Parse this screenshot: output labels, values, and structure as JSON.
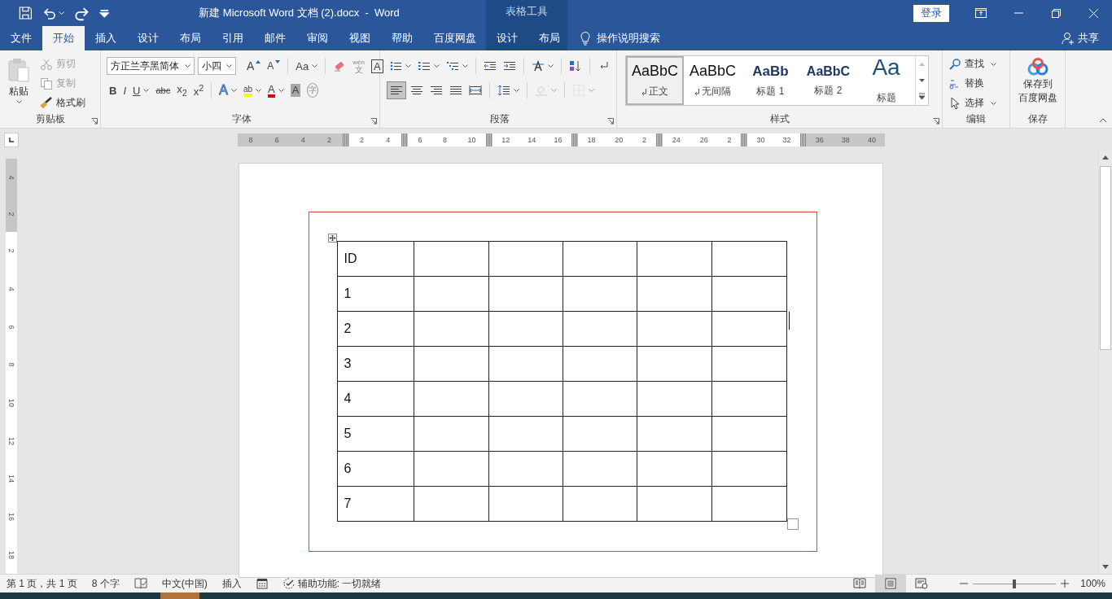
{
  "title_bar": {
    "title": "新建 Microsoft Word 文档 (2).docx  -  Word",
    "context_label": "表格工具",
    "sign_in": "登录"
  },
  "tabs": [
    {
      "label": "文件",
      "selected": false
    },
    {
      "label": "开始",
      "selected": true
    },
    {
      "label": "插入",
      "selected": false
    },
    {
      "label": "设计",
      "selected": false
    },
    {
      "label": "布局",
      "selected": false
    },
    {
      "label": "引用",
      "selected": false
    },
    {
      "label": "邮件",
      "selected": false
    },
    {
      "label": "审阅",
      "selected": false
    },
    {
      "label": "视图",
      "selected": false
    },
    {
      "label": "帮助",
      "selected": false
    },
    {
      "label": "百度网盘",
      "selected": false
    }
  ],
  "context_tabs": [
    {
      "label": "设计",
      "selected": false
    },
    {
      "label": "布局",
      "selected": false
    }
  ],
  "tell_me": "操作说明搜索",
  "share": "共享",
  "clipboard": {
    "label": "剪贴板",
    "paste": "粘贴",
    "items": [
      {
        "kind": "cut",
        "label": "剪切",
        "disabled": true
      },
      {
        "kind": "copy",
        "label": "复制",
        "disabled": true
      },
      {
        "kind": "painter",
        "label": "格式刷",
        "disabled": false
      }
    ]
  },
  "font": {
    "label": "字体",
    "font_name": "方正兰亭黑简体",
    "font_size": "小四",
    "row1": [
      [
        {
          "kind": "grow",
          "label": "A",
          "dropdown": false
        },
        {
          "kind": "shrink",
          "label": "A",
          "dropdown": false
        }
      ],
      [
        {
          "kind": "case",
          "label": "Aa",
          "dropdown": true
        }
      ],
      [
        {
          "kind": "clear",
          "dropdown": false
        },
        {
          "kind": "phonetic",
          "label": "wén",
          "label2": "文",
          "dropdown": false
        },
        {
          "kind": "boxed",
          "label": "A",
          "dropdown": false
        }
      ]
    ],
    "row2": [
      [
        {
          "kind": "bold",
          "label": "B",
          "dropdown": false
        },
        {
          "kind": "italic",
          "label": "I",
          "dropdown": false
        },
        {
          "kind": "underline",
          "label": "U",
          "dropdown": true
        },
        {
          "kind": "strike",
          "label": "abc",
          "dropdown": false
        },
        {
          "kind": "script",
          "label": "x$_{2}$",
          "dropdown": false
        },
        {
          "kind": "script",
          "label": "x$^{2}$",
          "dropdown": false
        }
      ],
      [
        {
          "kind": "effects",
          "label": "A",
          "dropdown": true
        },
        {
          "kind": "highlight",
          "label": "ab",
          "dropdown": true
        },
        {
          "kind": "color",
          "label": "A",
          "dropdown": true
        },
        {
          "kind": "shade",
          "label": "A",
          "dropdown": false
        },
        {
          "kind": "enclose",
          "label": "字",
          "dropdown": false
        }
      ]
    ]
  },
  "paragraph": {
    "label": "段落",
    "row1": [
      [
        {
          "kind": "bullets",
          "dropdown": true,
          "selected": false,
          "disabled": false
        },
        {
          "kind": "numbering",
          "dropdown": true,
          "selected": false,
          "disabled": false
        },
        {
          "kind": "multilevel",
          "dropdown": true,
          "selected": false,
          "disabled": false
        }
      ],
      [
        {
          "kind": "outdent",
          "dropdown": false,
          "selected": false,
          "disabled": false
        },
        {
          "kind": "indent",
          "dropdown": false,
          "selected": false,
          "disabled": false
        }
      ],
      [
        {
          "kind": "asian",
          "dropdown": true,
          "selected": false,
          "disabled": false
        }
      ],
      [
        {
          "kind": "sort",
          "dropdown": false,
          "selected": false,
          "disabled": false
        }
      ],
      [
        {
          "kind": "marks",
          "dropdown": false,
          "selected": false,
          "disabled": false
        }
      ]
    ],
    "row2": [
      [
        {
          "kind": "align-left",
          "dropdown": false,
          "selected": true,
          "disabled": false
        },
        {
          "kind": "align-center",
          "dropdown": false,
          "selected": false,
          "disabled": false
        },
        {
          "kind": "align-right",
          "dropdown": false,
          "selected": false,
          "disabled": false
        },
        {
          "kind": "justify",
          "dropdown": false,
          "selected": false,
          "disabled": false
        },
        {
          "kind": "distribute",
          "dropdown": false,
          "selected": false,
          "disabled": false
        }
      ],
      [
        {
          "kind": "line-spacing",
          "dropdown": true,
          "selected": false,
          "disabled": false
        }
      ],
      [
        {
          "kind": "shading",
          "dropdown": true,
          "selected": false,
          "disabled": true
        }
      ],
      [
        {
          "kind": "borders",
          "dropdown": true,
          "selected": false,
          "disabled": true
        }
      ]
    ]
  },
  "styles": {
    "label": "样式",
    "items": [
      {
        "kind": "body",
        "preview": "AaBbC",
        "name": "正文",
        "para_mark": true,
        "selected": true
      },
      {
        "kind": "body",
        "preview": "AaBbC",
        "name": "无间隔",
        "para_mark": true,
        "selected": false
      },
      {
        "kind": "heading1",
        "preview": "AaBb",
        "name": "标题 1",
        "para_mark": false,
        "selected": false
      },
      {
        "kind": "heading2",
        "preview": "AaBbC",
        "name": "标题 2",
        "para_mark": false,
        "selected": false
      },
      {
        "kind": "title",
        "preview": "Aa",
        "name": "标题",
        "para_mark": false,
        "selected": false
      }
    ]
  },
  "editing": {
    "label": "编辑",
    "items": [
      {
        "kind": "find",
        "label": "查找",
        "dropdown": true
      },
      {
        "kind": "replace",
        "label": "替换",
        "dropdown": false
      },
      {
        "kind": "select",
        "label": "选择",
        "dropdown": true
      }
    ]
  },
  "save": {
    "label": "保存",
    "button": [
      "保存到",
      "百度网盘"
    ]
  },
  "ruler": {
    "segments": [
      {
        "shaded": true,
        "labels": [
          "8",
          "6",
          "4",
          "2"
        ]
      },
      {
        "shaded": false,
        "labels": [
          "2",
          "4"
        ]
      },
      {
        "shaded": false,
        "labels": [
          "6",
          "8",
          "10"
        ]
      },
      {
        "shaded": false,
        "labels": [
          "12",
          "14",
          "16"
        ]
      },
      {
        "shaded": false,
        "labels": [
          "18",
          "20",
          "2"
        ]
      },
      {
        "shaded": false,
        "labels": [
          "24",
          "26",
          "2"
        ]
      },
      {
        "shaded": false,
        "labels": [
          "30",
          "32"
        ]
      },
      {
        "shaded": true,
        "labels": [
          "36",
          "38",
          "40"
        ]
      }
    ],
    "vertical": [
      {
        "shaded": true,
        "labels": [
          "4",
          "2"
        ]
      },
      {
        "shaded": false,
        "labels": [
          "2",
          "4",
          "6",
          "8",
          "10",
          "12",
          "14",
          "16",
          "18"
        ]
      }
    ]
  },
  "table": {
    "rows": [
      {
        "first": "ID"
      },
      {
        "first": "1"
      },
      {
        "first": "2"
      },
      {
        "first": "3"
      },
      {
        "first": "4"
      },
      {
        "first": "5"
      },
      {
        "first": "6"
      },
      {
        "first": "7"
      }
    ]
  },
  "status_bar": {
    "items": [
      {
        "kind": "text",
        "label": "第 1 页，共 1 页"
      },
      {
        "kind": "text",
        "label": "8 个字"
      },
      {
        "kind": "proofing"
      },
      {
        "kind": "text",
        "label": "中文(中国)"
      },
      {
        "kind": "text",
        "label": "插入"
      },
      {
        "kind": "macro"
      },
      {
        "kind": "accessibility",
        "label": "辅助功能: 一切就绪"
      }
    ],
    "views": [
      {
        "kind": "read",
        "selected": false
      },
      {
        "kind": "print",
        "selected": true
      },
      {
        "kind": "web",
        "selected": false
      }
    ],
    "zoom": {
      "level": 0.5,
      "label": "100%"
    }
  }
}
